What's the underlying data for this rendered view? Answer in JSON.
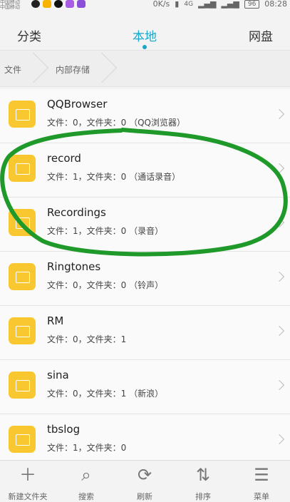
{
  "status_bar": {
    "carrier_top": "中国移动",
    "carrier_bottom": "中国移动",
    "speed": "0K/s",
    "network": "4G",
    "battery": "96",
    "time": "08:28"
  },
  "tabs": [
    {
      "label": "分类"
    },
    {
      "label": "本地",
      "active": true
    },
    {
      "label": "网盘"
    }
  ],
  "breadcrumb": [
    "文件",
    "内部存储"
  ],
  "files": [
    {
      "name": "QQBrowser",
      "meta": "文件：0，文件夹：0  （QQ浏览器）"
    },
    {
      "name": "record",
      "meta": "文件：1，文件夹：0  （通话录音）"
    },
    {
      "name": "Recordings",
      "meta": "文件：1，文件夹：0  （录音）"
    },
    {
      "name": "Ringtones",
      "meta": "文件：0，文件夹：0  （铃声）"
    },
    {
      "name": "RM",
      "meta": "文件：0，文件夹：1"
    },
    {
      "name": "sina",
      "meta": "文件：0，文件夹：1  （新浪）"
    },
    {
      "name": "tbslog",
      "meta": "文件：1，文件夹：0"
    }
  ],
  "toolbar": [
    {
      "label": "新建文件夹",
      "icon": "plus-icon"
    },
    {
      "label": "搜索",
      "icon": "search-icon"
    },
    {
      "label": "刷新",
      "icon": "refresh-icon"
    },
    {
      "label": "排序",
      "icon": "sort-icon"
    },
    {
      "label": "菜单",
      "icon": "menu-icon"
    }
  ],
  "colors": {
    "accent": "#1aa6c8",
    "folder": "#f9c730",
    "annotation": "#1f9a2a"
  }
}
